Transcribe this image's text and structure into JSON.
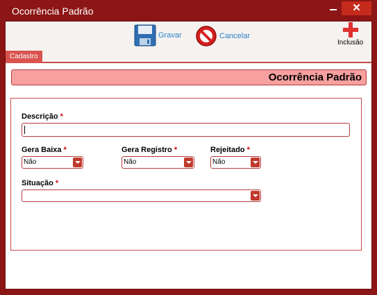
{
  "window": {
    "title": "Ocorrência Padrão",
    "close_glyph": "✕"
  },
  "toolbar": {
    "save_label": "Gravar",
    "cancel_label": "Cancelar",
    "new_label": "Inclusão"
  },
  "tabs": [
    {
      "label": "Cadastro"
    }
  ],
  "form": {
    "header": "Ocorrência Padrão",
    "descricao_label": "Descrição",
    "descricao_value": "",
    "gera_baixa_label": "Gera Baixa",
    "gera_baixa_value": "Não",
    "gera_registro_label": "Gera Registro",
    "gera_registro_value": "Não",
    "rejeitado_label": "Rejeitado",
    "rejeitado_value": "Não",
    "situacao_label": "Situação",
    "situacao_value": "",
    "required_mark": "*"
  },
  "colors": {
    "frame": "#8c1515",
    "accent": "#d9534f",
    "header_bg": "#f7a0a0",
    "required": "#d40000",
    "link": "#2a83c8"
  },
  "icons": [
    "save-icon",
    "cancel-icon",
    "add-icon",
    "minimize-icon",
    "close-icon",
    "dropdown-arrow-icon"
  ]
}
